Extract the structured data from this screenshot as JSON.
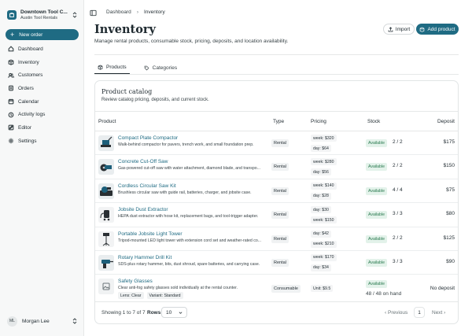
{
  "org": {
    "name": "Downtown Tool C...",
    "sub": "Austin Tool Rentals"
  },
  "sidebar": {
    "new_order": "New order",
    "items": [
      {
        "label": "Dashboard",
        "icon": "dashboard-icon"
      },
      {
        "label": "Inventory",
        "icon": "box-icon"
      },
      {
        "label": "Customers",
        "icon": "users-icon"
      },
      {
        "label": "Orders",
        "icon": "orders-icon"
      },
      {
        "label": "Calendar",
        "icon": "calendar-icon"
      },
      {
        "label": "Activity logs",
        "icon": "activity-icon"
      },
      {
        "label": "Editor",
        "icon": "editor-icon"
      },
      {
        "label": "Settings",
        "icon": "gear-icon"
      }
    ],
    "user": {
      "initials": "ML",
      "name": "Morgan Lee"
    }
  },
  "breadcrumb": {
    "parent": "Dashboard",
    "current": "Inventory"
  },
  "page": {
    "title": "Inventory",
    "subtitle": "Manage rental products, consumable stock, pricing, deposits, and location availability.",
    "import_label": "Import",
    "add_label": "Add product"
  },
  "tabs": [
    {
      "label": "Products"
    },
    {
      "label": "Categories"
    }
  ],
  "catalog": {
    "title": "Product catalog",
    "subtitle": "Review catalog pricing, deposits, and current stock.",
    "headers": {
      "product": "Product",
      "type": "Type",
      "pricing": "Pricing",
      "stock": "Stock",
      "deposit": "Deposit"
    },
    "rows": [
      {
        "name": "Compact Plate Compactor",
        "desc": "Walk-behind compactor for pavers, trench work, and small foundation prep.",
        "type": "Rental",
        "price1": "week: $320",
        "price2": "day: $64",
        "status": "Available",
        "qty": "2 / 2",
        "deposit": "$175",
        "thumb": "compactor"
      },
      {
        "name": "Concrete Cut-Off Saw",
        "desc": "Gas-powered cut-off saw with water attachment, diamond blade, and transpo...",
        "type": "Rental",
        "price1": "week: $280",
        "price2": "day: $56",
        "status": "Available",
        "qty": "2 / 2",
        "deposit": "$150",
        "thumb": "saw"
      },
      {
        "name": "Cordless Circular Saw Kit",
        "desc": "Brushless circular saw with guide rail, batteries, charger, and jobsite case.",
        "type": "Rental",
        "price1": "week: $140",
        "price2": "day: $28",
        "status": "Available",
        "qty": "4 / 4",
        "deposit": "$75",
        "thumb": "kit"
      },
      {
        "name": "Jobsite Dust Extractor",
        "desc": "HEPA dust extractor with hose kit, replacement bags, and tool-trigger adapter.",
        "type": "Rental",
        "price1": "day: $30",
        "price2": "week: $150",
        "status": "Available",
        "qty": "3 / 3",
        "deposit": "$80",
        "thumb": "extractor"
      },
      {
        "name": "Portable Jobsite Light Tower",
        "desc": "Tripod-mounted LED light tower with extension cord set and weather-rated co...",
        "type": "Rental",
        "price1": "day: $42",
        "price2": "week: $210",
        "status": "Available",
        "qty": "2 / 2",
        "deposit": "$125",
        "thumb": "light"
      },
      {
        "name": "Rotary Hammer Drill Kit",
        "desc": "SDS-plus rotary hammer, bits, dust shroud, spare batteries, and carrying case.",
        "type": "Rental",
        "price1": "week: $170",
        "price2": "day: $34",
        "status": "Available",
        "qty": "3 / 3",
        "deposit": "$90",
        "thumb": "drill"
      }
    ],
    "consumable": {
      "name": "Safety Glasses",
      "desc": "Clear anti-fog safety glasses sold individually at the rental counter.",
      "tag1": "Lens: Clear",
      "tag2": "Variant: Standard",
      "type": "Consumable",
      "price": "Unit: $9.5",
      "status": "Available",
      "onhand": "48 / 48 on hand",
      "deposit": "No deposit"
    },
    "pager": {
      "showing": "Showing 1 to 7 of 7",
      "rows_label": "Rows",
      "rows_value": "10",
      "prev": "Previous",
      "page": "1",
      "next": "Next"
    }
  },
  "colors": {
    "accent": "#1f6b83",
    "available_bg": "#e3f2ea",
    "available_text": "#2a7a4f"
  }
}
